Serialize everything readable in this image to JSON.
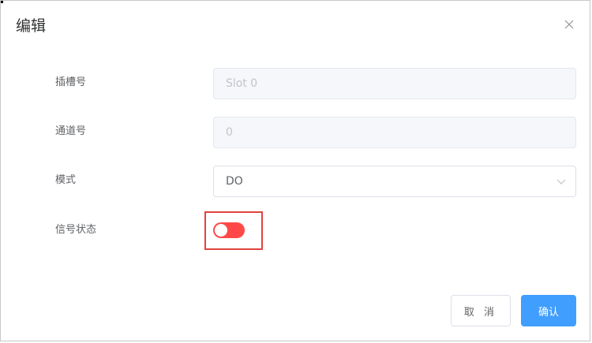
{
  "dialog": {
    "title": "编辑",
    "close_icon": "close-icon"
  },
  "form": {
    "slot": {
      "label": "插槽号",
      "value": "Slot 0"
    },
    "channel": {
      "label": "通道号",
      "value": "0"
    },
    "mode": {
      "label": "模式",
      "value": "DO",
      "icon": "chevron-down-icon"
    },
    "signal": {
      "label": "信号状态",
      "state": "off",
      "track_color": "#ff4949"
    }
  },
  "footer": {
    "cancel_label": "取 消",
    "confirm_label": "确认"
  },
  "colors": {
    "accent": "#409eff",
    "highlight": "#e0443e"
  }
}
